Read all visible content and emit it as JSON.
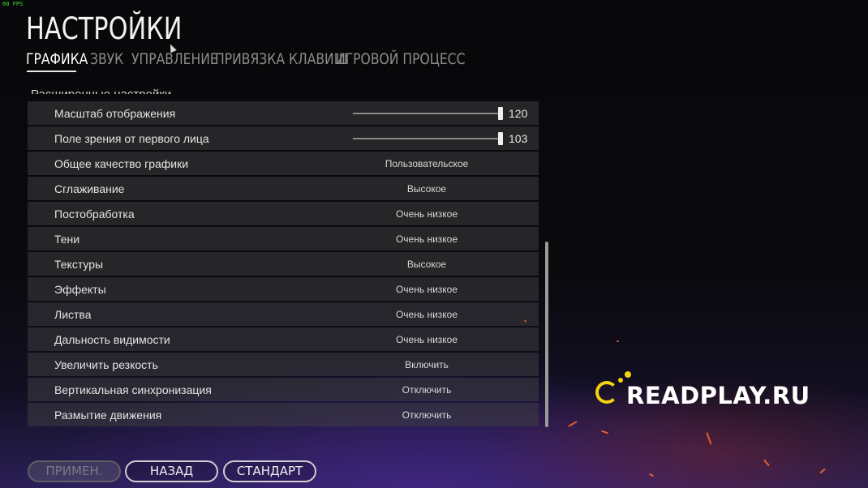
{
  "fps": "60 FPS",
  "page_title": "НАСТРОЙКИ",
  "tabs": [
    {
      "label": "ГРАФИКА",
      "active": true
    },
    {
      "label": "ЗВУК",
      "active": false
    },
    {
      "label": "УПРАВЛЕНИЕ",
      "active": false
    },
    {
      "label": "ПРИВЯЗКА КЛАВИШ",
      "active": false
    },
    {
      "label": "ИГРОВОЙ ПРОЦЕСС",
      "active": false
    }
  ],
  "section_header": "Расширенные настройки",
  "sliders": [
    {
      "label": "Масштаб отображения",
      "value": "120",
      "fill": 1.0
    },
    {
      "label": "Поле зрения от первого лица",
      "value": "103",
      "fill": 1.0
    }
  ],
  "settings": [
    {
      "label": "Общее качество графики",
      "value": "Пользовательское"
    },
    {
      "label": "Сглаживание",
      "value": "Высокое"
    },
    {
      "label": "Постобработка",
      "value": "Очень низкое"
    },
    {
      "label": "Тени",
      "value": "Очень низкое"
    },
    {
      "label": "Текстуры",
      "value": "Высокое"
    },
    {
      "label": "Эффекты",
      "value": "Очень низкое"
    },
    {
      "label": "Листва",
      "value": "Очень низкое"
    },
    {
      "label": "Дальность видимости",
      "value": "Очень низкое"
    },
    {
      "label": "Увеличить резкость",
      "value": "Включить"
    },
    {
      "label": "Вертикальная синхронизация",
      "value": "Отключить"
    },
    {
      "label": "Размытие движения",
      "value": "Отключить"
    }
  ],
  "buttons": {
    "apply": "ПРИМЕН.",
    "back": "НАЗАД",
    "default": "СТАНДАРТ"
  },
  "watermark": "READPLAY.RU",
  "colors": {
    "accent": "#f3d20f",
    "row_bg": "#3e3e42",
    "spark": "#ff6a2a"
  }
}
